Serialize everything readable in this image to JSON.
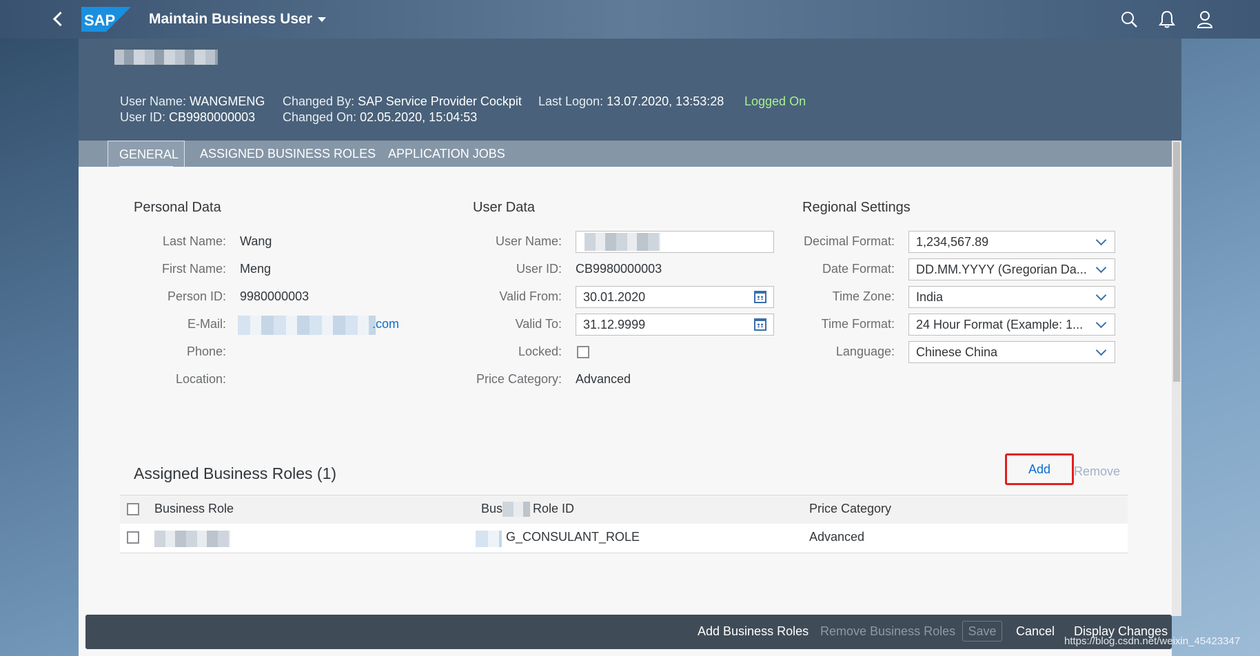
{
  "shell": {
    "title": "Maintain Business User",
    "logo_text": "SAP",
    "icons": [
      "back-icon",
      "search-icon",
      "bell-icon",
      "user-icon"
    ]
  },
  "header": {
    "user_name_label": "User Name:",
    "user_name": "WANGMENG",
    "user_id_label": "User ID:",
    "user_id": "CB9980000003",
    "changed_by_label": "Changed By:",
    "changed_by": "SAP Service Provider Cockpit",
    "changed_on_label": "Changed On:",
    "changed_on": "02.05.2020, 15:04:53",
    "last_logon_label": "Last Logon:",
    "last_logon": "13.07.2020, 13:53:28",
    "status": "Logged On",
    "status_color": "#a9f093"
  },
  "tabs": [
    "GENERAL",
    "ASSIGNED BUSINESS ROLES",
    "APPLICATION JOBS"
  ],
  "personal": {
    "title": "Personal Data",
    "last_name_label": "Last Name:",
    "last_name": "Wang",
    "first_name_label": "First Name:",
    "first_name": "Meng",
    "person_id_label": "Person ID:",
    "person_id": "9980000003",
    "email_label": "E-Mail:",
    "email_suffix": ".com",
    "phone_label": "Phone:",
    "location_label": "Location:"
  },
  "userdata": {
    "title": "User Data",
    "user_name_label": "User Name:",
    "user_id_label": "User ID:",
    "user_id": "CB9980000003",
    "valid_from_label": "Valid From:",
    "valid_from": "30.01.2020",
    "valid_to_label": "Valid To:",
    "valid_to": "31.12.9999",
    "locked_label": "Locked:",
    "price_category_label": "Price Category:",
    "price_category": "Advanced"
  },
  "regional": {
    "title": "Regional Settings",
    "decimal_label": "Decimal Format:",
    "decimal": "1,234,567.89",
    "date_label": "Date Format:",
    "date": "DD.MM.YYYY (Gregorian Da...",
    "timezone_label": "Time Zone:",
    "timezone": "India",
    "timeformat_label": "Time Format:",
    "timeformat": "24 Hour Format (Example: 1...",
    "language_label": "Language:",
    "language": "Chinese China"
  },
  "roles": {
    "title": "Assigned Business Roles (1)",
    "add": "Add",
    "remove": "Remove",
    "col_role": "Business Role",
    "col_role_id_prefix": "Bus",
    "col_role_id": "Role ID",
    "col_price": "Price Category",
    "row_role_id": "G_CONSULANT_ROLE",
    "row_price": "Advanced"
  },
  "footer": {
    "add_roles": "Add Business Roles",
    "remove_roles": "Remove Business Roles",
    "save": "Save",
    "cancel": "Cancel",
    "display_changes": "Display Changes"
  },
  "watermark": "https://blog.csdn.net/weixin_45423347",
  "colors": {
    "accent": "#0a6ed1",
    "highlight": "#e02020",
    "shell": "#49617a"
  }
}
